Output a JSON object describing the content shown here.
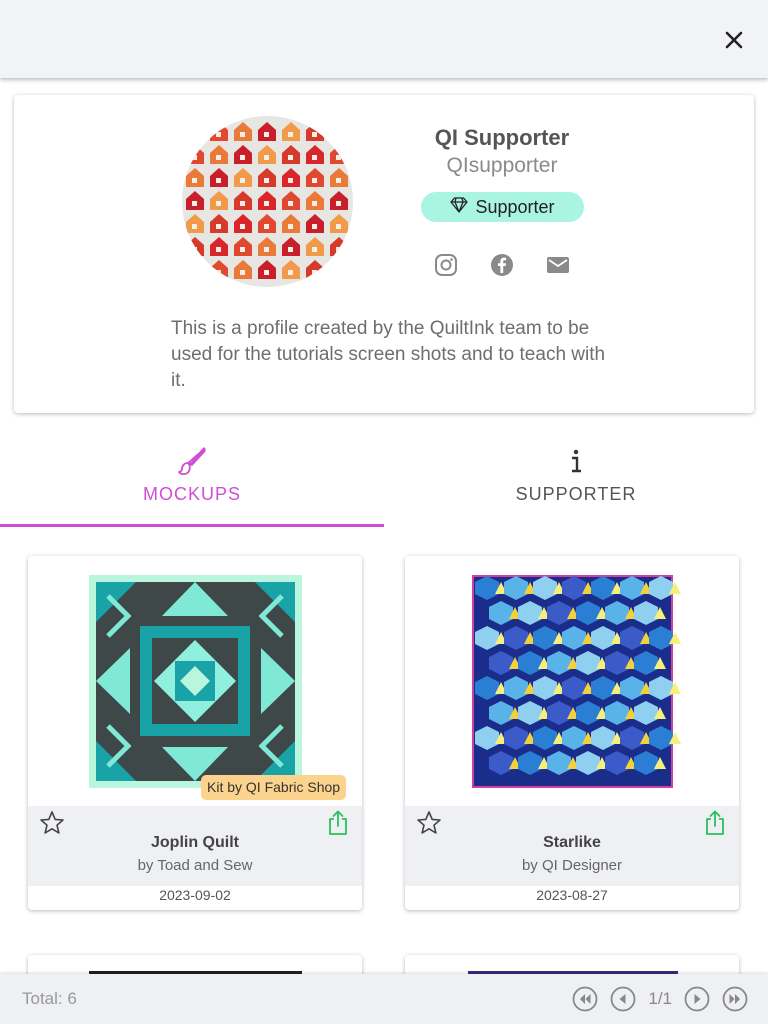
{
  "header": {
    "close_icon": "close-icon"
  },
  "profile": {
    "name": "QI Supporter",
    "handle": "QIsupporter",
    "badge_label": "Supporter",
    "badge_icon": "diamond-icon",
    "bio": "This is a profile created by the QuiltInk team to be used for the tutorials screen shots and to teach with it.",
    "social_icons": [
      "instagram-icon",
      "facebook-icon",
      "email-icon"
    ]
  },
  "tabs": [
    {
      "label": "MOCKUPS",
      "icon": "paintbrush-icon",
      "active": true
    },
    {
      "label": "SUPPORTER",
      "icon": "info-icon",
      "active": false
    }
  ],
  "colors": {
    "accent": "#cf4ed4",
    "badge_bg": "#a9f4e2",
    "kit_badge_bg": "#fbd38c",
    "share_green": "#2bbf5a"
  },
  "mockups": [
    {
      "title": "Joplin Quilt",
      "author": "by Toad and Sew",
      "date": "2023-09-02",
      "kit_label": "Kit by QI Fabric Shop"
    },
    {
      "title": "Starlike",
      "author": "by QI Designer",
      "date": "2023-08-27",
      "kit_label": ""
    }
  ],
  "footer": {
    "total": "Total: 6",
    "page": "1/1"
  }
}
